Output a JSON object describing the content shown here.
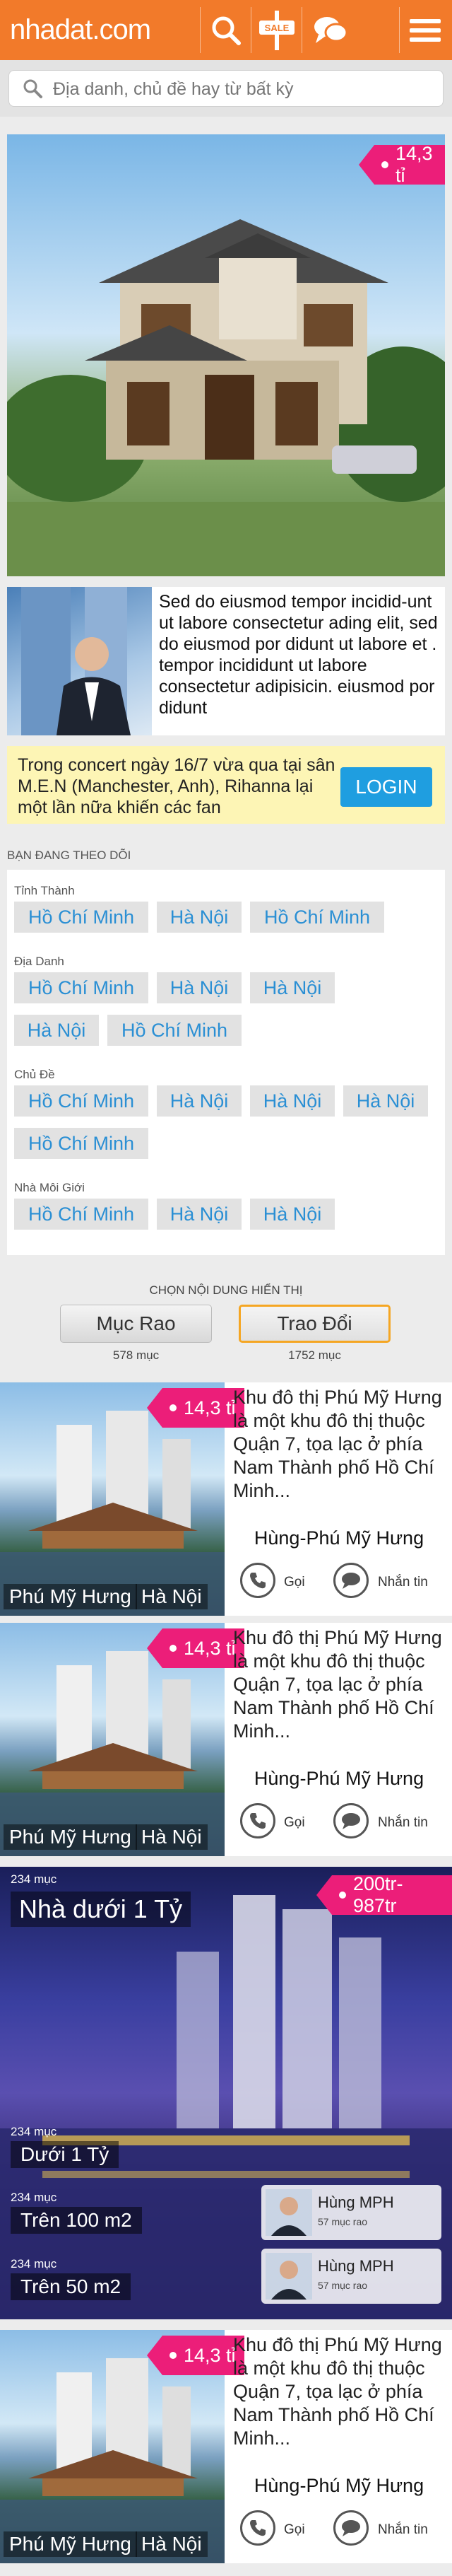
{
  "header": {
    "logo": "nhadat.com",
    "sale_badge": "SALE"
  },
  "search": {
    "placeholder": "Địa danh, chủ đề hay từ bất kỳ"
  },
  "hero": {
    "price": "14,3 tỉ"
  },
  "promo": {
    "text": "Sed do eiusmod tempor incidid-unt ut labore consectetur ading elit, sed do eiusmod por didunt ut labore et . tempor incididunt ut labore consectetur adipisicin. eiusmod por didunt"
  },
  "banner": {
    "text": "Trong concert ngày 16/7 vừa qua tại sân M.E.N (Manchester, Anh), Rihanna lại một lần nữa khiến các fan",
    "login": "LOGIN"
  },
  "following": {
    "title": "BẠN ĐANG THEO DÕI",
    "groups": [
      {
        "label": "Tỉnh Thành",
        "chips": [
          "Hồ Chí Minh",
          "Hà Nội",
          "Hồ Chí Minh"
        ]
      },
      {
        "label": "Địa Danh",
        "chips": [
          "Hồ Chí Minh",
          "Hà Nội",
          "Hà Nội",
          "Hà Nội",
          "Hồ Chí Minh"
        ]
      },
      {
        "label": "Chủ Đề",
        "chips": [
          "Hồ Chí Minh",
          "Hà Nội",
          "Hà Nội",
          "Hà Nội",
          "Hồ Chí Minh"
        ]
      },
      {
        "label": "Nhà Môi Giới",
        "chips": [
          "Hồ Chí Minh",
          "Hà Nội",
          "Hà Nội"
        ]
      }
    ]
  },
  "content_choice": {
    "title": "CHỌN NỘI DUNG HIỂN THỊ",
    "options": [
      {
        "label": "Mục Rao",
        "count": "578 mục"
      },
      {
        "label": "Trao Đổi",
        "count": "1752 mục"
      }
    ]
  },
  "listings": [
    {
      "price": "14,3 tỉ",
      "desc": "Khu đô thị Phú Mỹ Hưng là một khu đô thị thuộc Quận 7, tọa lạc ở phía Nam Thành phố Hồ Chí Minh...",
      "name": "Hùng-Phú Mỹ Hưng",
      "loc1": "Phú Mỹ Hưng",
      "loc2": "Hà Nội",
      "call": "Gọi",
      "msg": "Nhắn tin"
    },
    {
      "price": "14,3 tỉ",
      "desc": "Khu đô thị Phú Mỹ Hưng là một khu đô thị thuộc Quận 7, tọa lạc ở phía Nam Thành phố Hồ Chí Minh...",
      "name": "Hùng-Phú Mỹ Hưng",
      "loc1": "Phú Mỹ Hưng",
      "loc2": "Hà Nội",
      "call": "Gọi",
      "msg": "Nhắn tin"
    },
    {
      "price": "14,3 tỉ",
      "desc": "Khu đô thị Phú Mỹ Hưng là một khu đô thị thuộc Quận 7, tọa lạc ở phía Nam Thành phố Hồ Chí Minh...",
      "name": "Hùng-Phú Mỹ Hưng",
      "loc1": "Phú Mỹ Hưng",
      "loc2": "Hà Nội",
      "call": "Gọi",
      "msg": "Nhắn tin"
    }
  ],
  "category_block": {
    "count_main": "234 mục",
    "title": "Nhà dưới 1 Tỷ",
    "price": "200tr-987tr",
    "subs": [
      {
        "count": "234 mục",
        "label": "Dưới 1 Tỷ"
      },
      {
        "count": "234 mục",
        "label": "Trên 100 m2"
      },
      {
        "count": "234 mục",
        "label": "Trên 50 m2"
      }
    ],
    "agents": [
      {
        "name": "Hùng MPH",
        "count": "57 mục rao"
      },
      {
        "name": "Hùng MPH",
        "count": "57 mục rao"
      }
    ]
  },
  "colors": {
    "brand": "#f27a2a",
    "price": "#ec1e79",
    "link": "#2a8fd4",
    "login": "#1f9ee0",
    "banner": "#fdf5b5"
  }
}
